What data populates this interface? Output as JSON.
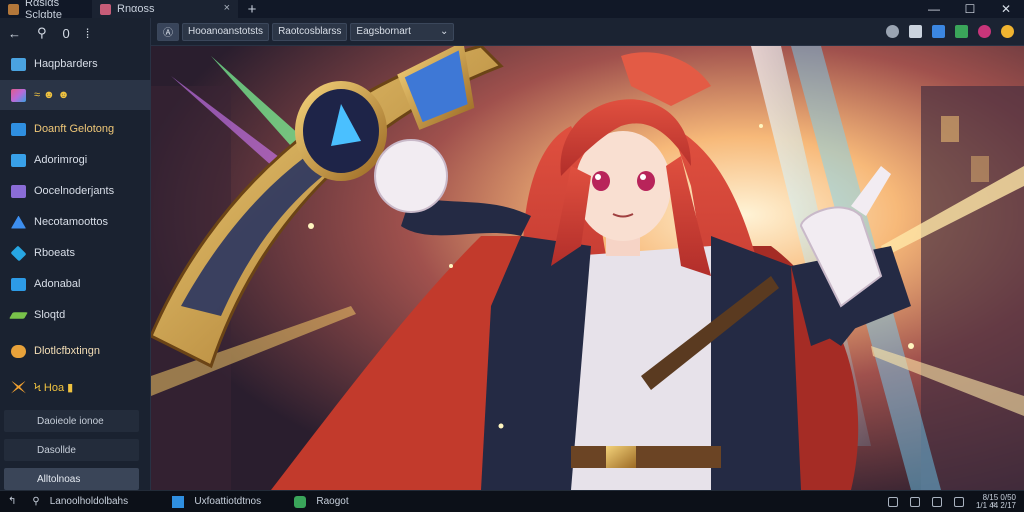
{
  "browser": {
    "tabs": [
      {
        "title": "Rαsiαs Sclαbte",
        "icon_color": "#b3773a"
      },
      {
        "title": "Rnαoss",
        "icon_color": "#c75c78"
      }
    ],
    "close_glyph": "×",
    "new_tab_glyph": "+",
    "window_controls": {
      "minimize": "—",
      "maximize": "☐",
      "close": "✕"
    }
  },
  "sidebar": {
    "nav": {
      "back": "←",
      "wand": "⚲",
      "other": "0",
      "pin": "⁞"
    },
    "items": [
      {
        "label": "Haqpbarders",
        "icon": "folder-icon",
        "color": "#4aa3e0"
      },
      {
        "label": "≈ ☻ ☻",
        "icon": "palette-icon",
        "color": "#b96ad9",
        "selected": true
      },
      {
        "label": "Doanft Gelotong",
        "icon": "layers-icon",
        "color": "#2f8fe0"
      },
      {
        "label": "Adorimrogi",
        "icon": "image-icon",
        "color": "#38a0e8"
      },
      {
        "label": "Oocelnoderjants",
        "icon": "grid-icon",
        "color": "#8a6cd6"
      },
      {
        "label": "Necotamoottos",
        "icon": "figure-icon",
        "color": "#3d8ff0"
      },
      {
        "label": "Rboeats",
        "icon": "cube-icon",
        "color": "#27a6e2"
      },
      {
        "label": "Adonabal",
        "icon": "panel-icon",
        "color": "#2d9be6"
      },
      {
        "label": "Sloqtd",
        "icon": "brush-icon",
        "color": "#78c24a"
      },
      {
        "label": "Dlotlcfbxtingn",
        "icon": "cloud-icon",
        "color": "#e8a23a"
      },
      {
        "label": "Ϟ Hoa ▮",
        "icon": "swords-icon",
        "color": "#f0a030"
      }
    ],
    "subitems": [
      "Daoieole ionoe",
      "Dasollde",
      "Alltolnoas"
    ]
  },
  "toolbar": {
    "buttons": [
      "Ⓐ",
      "Hooanoanstotsts",
      "Raotcosblarss"
    ],
    "dropdown": "Eagsbornart",
    "dropdown_glyph": "⌄"
  },
  "taskbar": {
    "start_glyph": "↰",
    "search_glyph": "⚲",
    "search_text": "Lanoolholdolbahs",
    "apps": [
      {
        "label": "Uxfoattiotdtnos",
        "color": "#2f8fe0"
      },
      {
        "label": "Raogot",
        "color": "#3aa55a"
      }
    ],
    "tray_time": [
      "8/15 0/50",
      "1/1 4ͦ4 2/17"
    ]
  }
}
